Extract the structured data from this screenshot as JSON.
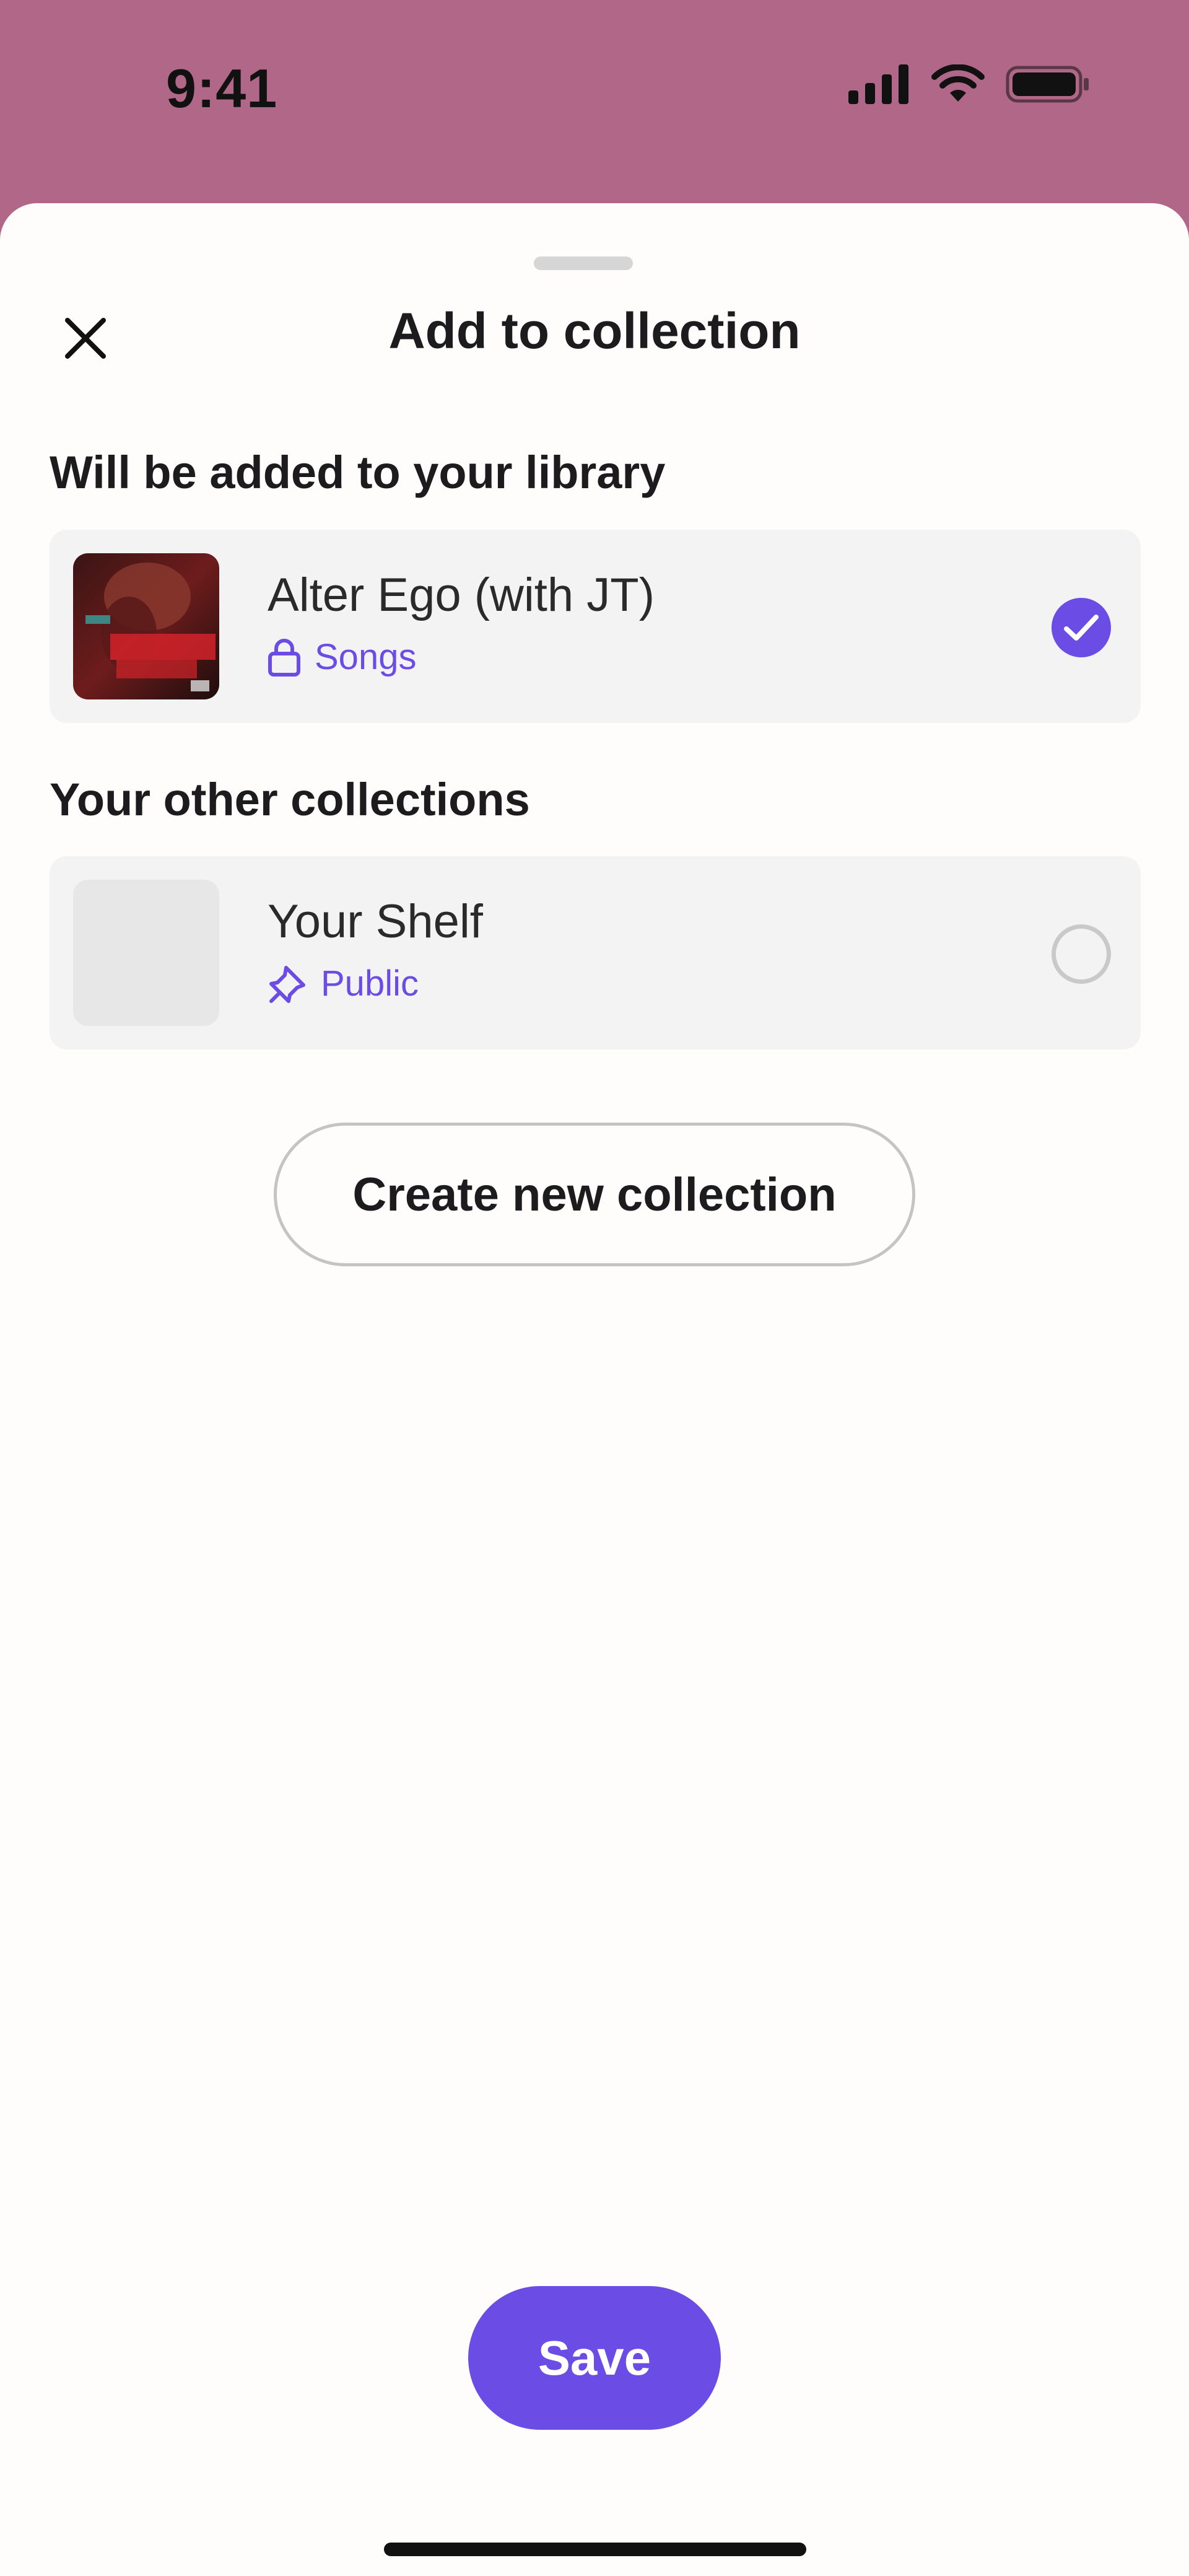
{
  "status_bar": {
    "time": "9:41"
  },
  "sheet": {
    "title": "Add to collection",
    "close_icon": "close-icon"
  },
  "library_section": {
    "label": "Will be added to your library",
    "item": {
      "title": "Alter Ego (with JT)",
      "subtitle": "Songs",
      "subtitle_icon": "lock-icon",
      "selected": true
    }
  },
  "other_section": {
    "label": "Your other collections",
    "items": [
      {
        "title": "Your Shelf",
        "subtitle": "Public",
        "subtitle_icon": "pin-icon",
        "selected": false
      }
    ]
  },
  "actions": {
    "create_label": "Create new collection",
    "save_label": "Save"
  },
  "colors": {
    "accent": "#6b4de6",
    "status_bar_bg": "#b16788",
    "sheet_bg": "#fefdfb",
    "row_bg": "#f3f3f3"
  }
}
